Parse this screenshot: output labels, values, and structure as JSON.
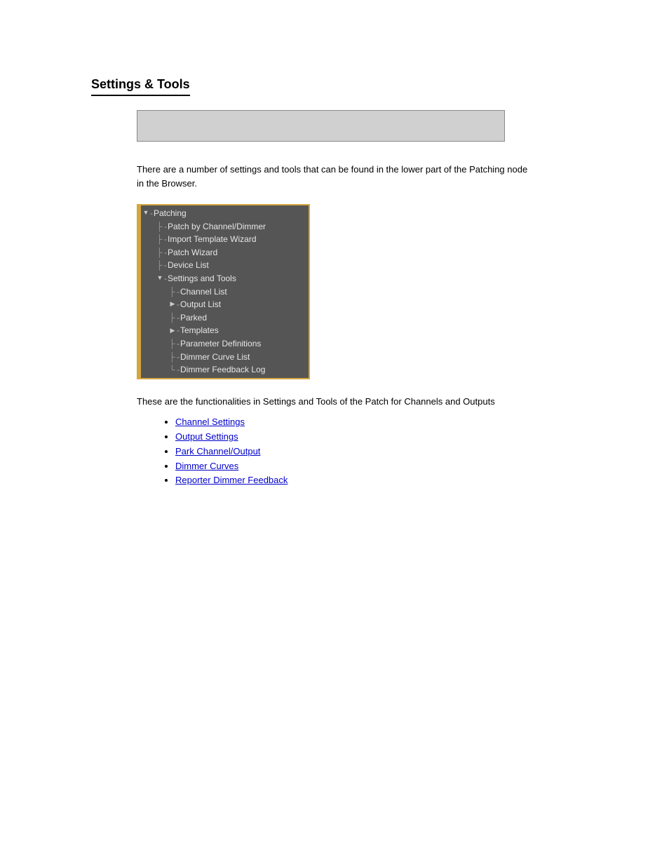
{
  "page": {
    "title": "Settings & Tools"
  },
  "intro": "There are a number of settings and tools that can be found in the lower part of the Patching node in the Browser.",
  "tree": {
    "root": {
      "label": "Patching",
      "arrow": "▼"
    },
    "level1": [
      {
        "label": "Patch by Channel/Dimmer"
      },
      {
        "label": "Import Template Wizard"
      },
      {
        "label": "Patch Wizard"
      },
      {
        "label": "Device List"
      }
    ],
    "settings": {
      "label": "Settings and Tools",
      "arrow": "▼"
    },
    "level2": [
      {
        "label": "Channel List",
        "arrow": ""
      },
      {
        "label": "Output List",
        "arrow": "▶"
      },
      {
        "label": "Parked",
        "arrow": ""
      },
      {
        "label": "Templates",
        "arrow": "▶"
      },
      {
        "label": "Parameter Definitions",
        "arrow": ""
      },
      {
        "label": "Dimmer Curve List",
        "arrow": ""
      },
      {
        "label": "Dimmer Feedback Log",
        "arrow": ""
      }
    ]
  },
  "desc2": "These are the functionalities in Settings and Tools of the Patch for Channels and Outputs",
  "links": [
    "Channel Settings",
    "Output Settings",
    "Park Channel/Output",
    "Dimmer Curves",
    "Reporter Dimmer Feedback"
  ]
}
